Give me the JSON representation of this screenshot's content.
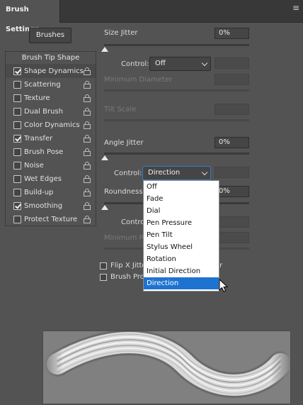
{
  "panel": {
    "tab_label": "Brush Settings",
    "menu_icon": "panel-menu-icon"
  },
  "brushes_button": "Brushes",
  "list": {
    "header": "Brush Tip Shape",
    "items": [
      {
        "label": "Shape Dynamics",
        "checked": true,
        "selected": true
      },
      {
        "label": "Scattering",
        "checked": false
      },
      {
        "label": "Texture",
        "checked": false
      },
      {
        "label": "Dual Brush",
        "checked": false
      },
      {
        "label": "Color Dynamics",
        "checked": false
      },
      {
        "label": "Transfer",
        "checked": true
      },
      {
        "label": "Brush Pose",
        "checked": false
      },
      {
        "label": "Noise",
        "checked": false
      },
      {
        "label": "Wet Edges",
        "checked": false
      },
      {
        "label": "Build-up",
        "checked": false
      },
      {
        "label": "Smoothing",
        "checked": true
      },
      {
        "label": "Protect Texture",
        "checked": false
      }
    ]
  },
  "controls": {
    "size_jitter": {
      "label": "Size Jitter",
      "value": "0%",
      "level": 0
    },
    "size_control": {
      "label": "Control:",
      "value": "Off"
    },
    "minimum_diameter": {
      "label": "Minimum Diameter"
    },
    "tilt_scale": {
      "label": "Tilt Scale"
    },
    "angle_jitter": {
      "label": "Angle Jitter",
      "value": "0%",
      "level": 0
    },
    "angle_control": {
      "label": "Control:",
      "value": "Direction"
    },
    "roundness_jitter": {
      "label": "Roundness J",
      "value": "0%",
      "level": 0
    },
    "roundness_control": {
      "label": "Contro"
    },
    "minimum_roundness": {
      "label": "Minimum Ro"
    },
    "flip_x": {
      "label": "Flip X Jitte",
      "suffix": "r"
    },
    "brush_projection": {
      "label": "Brush Pro"
    }
  },
  "dropdown": {
    "options": [
      "Off",
      "Fade",
      "Dial",
      "Pen Pressure",
      "Pen Tilt",
      "Stylus Wheel",
      "Rotation",
      "Initial Direction",
      "Direction"
    ],
    "highlighted": "Direction"
  },
  "colors": {
    "highlight": "#1f73d0",
    "panel_bg": "#535353"
  }
}
